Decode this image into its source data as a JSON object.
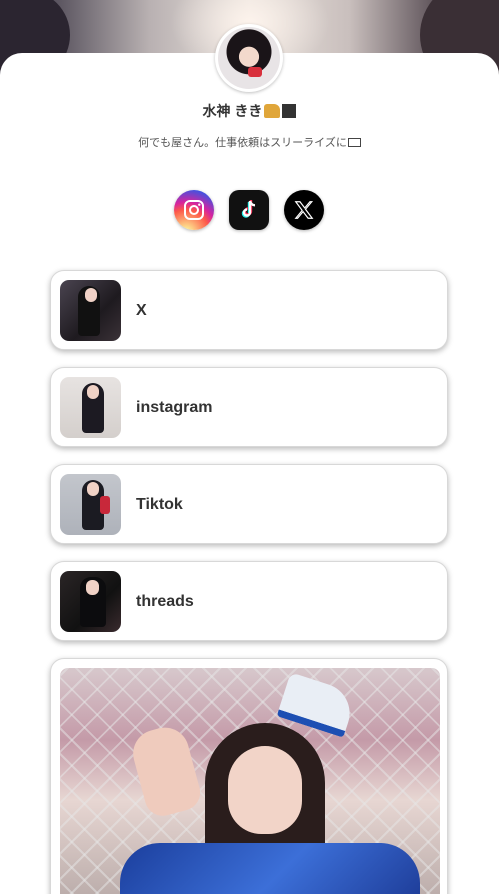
{
  "profile": {
    "name": "水神 きき",
    "bio": "何でも屋さん。仕事依頼はスリーライズに"
  },
  "socials": [
    {
      "name": "instagram",
      "icon": "instagram-icon",
      "color": "#d6249f"
    },
    {
      "name": "tiktok",
      "icon": "tiktok-icon",
      "color": "#111111"
    },
    {
      "name": "x",
      "icon": "x-icon",
      "color": "#000000"
    }
  ],
  "links": [
    {
      "label": "X"
    },
    {
      "label": "instagram"
    },
    {
      "label": "Tiktok"
    },
    {
      "label": "threads"
    }
  ]
}
